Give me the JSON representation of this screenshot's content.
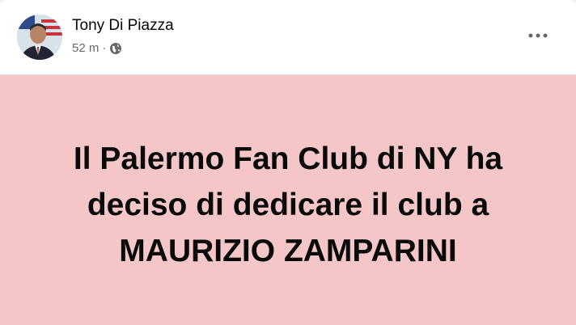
{
  "post": {
    "author": "Tony Di Piazza",
    "time": "52 m",
    "separator": "·",
    "audience_icon": "globe-icon",
    "more_icon": "more-options-icon",
    "text_lines": [
      "Il Palermo Fan Club di NY ha",
      "deciso di dedicare il club a",
      "MAURIZIO ZAMPARINI"
    ],
    "background_color": "#f4c6c8"
  }
}
